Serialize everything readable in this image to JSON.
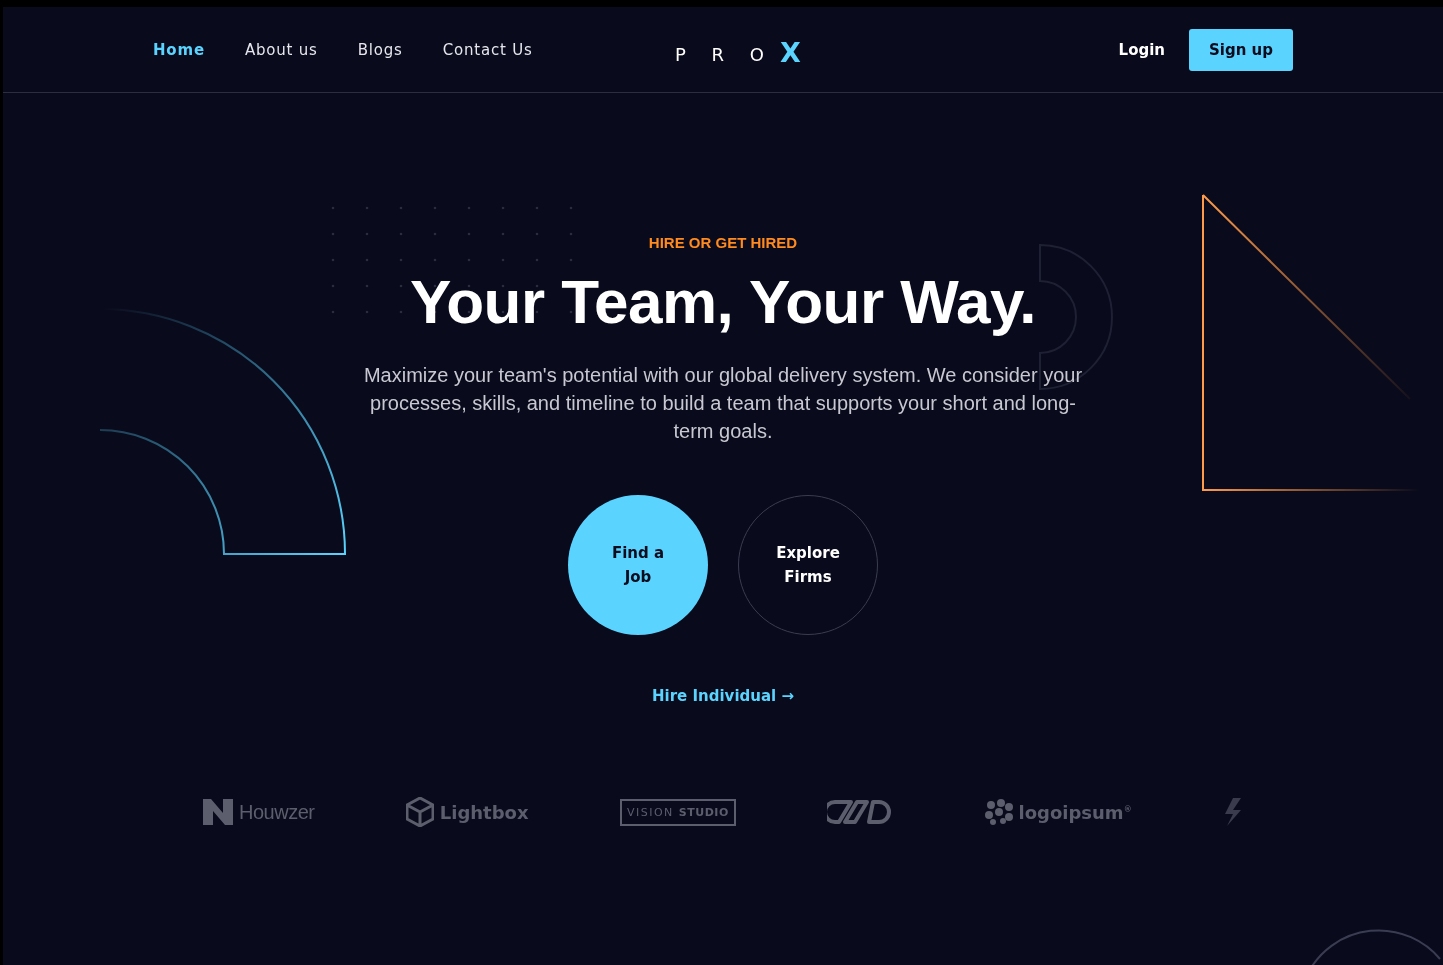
{
  "nav": {
    "links": [
      {
        "label": "Home",
        "selected": true
      },
      {
        "label": "About us",
        "selected": false
      },
      {
        "label": "Blogs",
        "selected": false
      },
      {
        "label": "Contact Us",
        "selected": false
      }
    ],
    "brand": {
      "letters": "P R O",
      "mark": "X"
    },
    "login": "Login",
    "signup": "Sign up"
  },
  "hero": {
    "eyebrow": "HIRE OR GET HIRED",
    "title": "Your Team, Your Way.",
    "description": "Maximize your team's potential with our global delivery system. We consider your processes, skills, and timeline to build a team that supports your short and long-term goals.",
    "actions": [
      {
        "label": "Find a Job",
        "kind": "primary"
      },
      {
        "label": "Explore Firms",
        "kind": "outline"
      }
    ],
    "link": {
      "label": "Hire Individual",
      "arrow": "→"
    }
  },
  "logos": [
    {
      "kind": "houwzer",
      "text": "Houwzer"
    },
    {
      "kind": "cube",
      "text": "Lightbox"
    },
    {
      "kind": "framed",
      "text": "VISION",
      "strong": "STUDIO"
    },
    {
      "kind": "chain"
    },
    {
      "kind": "dots",
      "text": "logoipsum",
      "sup": "®"
    },
    {
      "kind": "bolt"
    }
  ]
}
